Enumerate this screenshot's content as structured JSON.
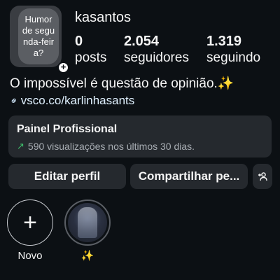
{
  "profile": {
    "note": "Humor de segunda-feira?",
    "badge": "+",
    "username": "kasantos",
    "stats": {
      "posts": {
        "value": "0",
        "label": "posts"
      },
      "followers": {
        "value": "2.054",
        "label": "seguidores"
      },
      "following": {
        "value": "1.319",
        "label": "seguindo"
      }
    },
    "bio": "O impossível é questão de opinião.✨",
    "link": "vsco.co/karlinhasants"
  },
  "pro_panel": {
    "title": "Painel Profissional",
    "subtitle": "590 visualizações nos últimos 30 dias."
  },
  "actions": {
    "edit": "Editar perfil",
    "share": "Compartilhar pe...",
    "add_user_icon": "add-person-icon"
  },
  "highlights": [
    {
      "label": "Novo",
      "icon": "plus-icon"
    },
    {
      "label": "✨",
      "icon": "highlight-cover"
    }
  ],
  "colors": {
    "background": "#0c1014",
    "card": "#25292e",
    "trend": "#3fbf6c"
  }
}
